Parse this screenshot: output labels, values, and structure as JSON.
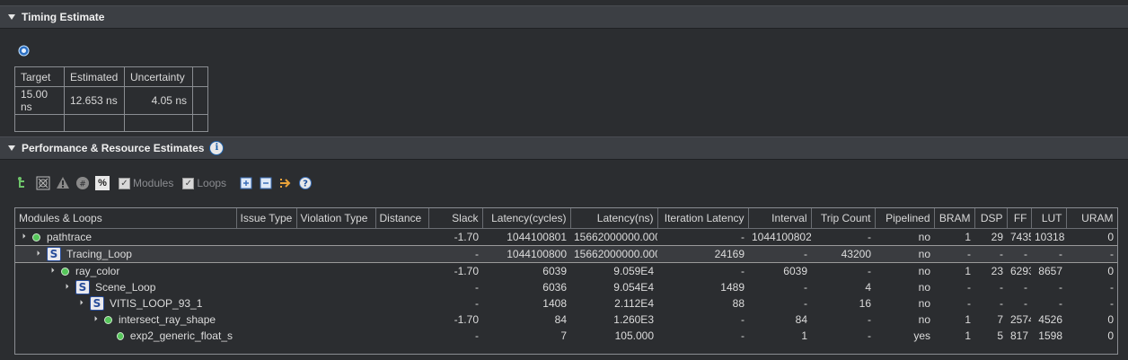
{
  "timing_section": {
    "title": "Timing Estimate"
  },
  "timing_table": {
    "headers": [
      "Target",
      "Estimated",
      "Uncertainty",
      ""
    ],
    "rows": [
      [
        "15.00 ns",
        "12.653 ns",
        "4.05 ns",
        ""
      ],
      [
        "",
        "",
        "",
        ""
      ]
    ]
  },
  "perf_section": {
    "title": "Performance & Resource Estimates"
  },
  "toolbar": {
    "modules_label": "Modules",
    "loops_label": "Loops"
  },
  "grid": {
    "headers": [
      "Modules & Loops",
      "Issue Type",
      "Violation Type",
      "Distance",
      "Slack",
      "Latency(cycles)",
      "Latency(ns)",
      "Iteration Latency",
      "Interval",
      "Trip Count",
      "Pipelined",
      "BRAM",
      "DSP",
      "FF",
      "LUT",
      "URAM"
    ],
    "rows": [
      {
        "name": "pathtrace",
        "type": "module",
        "level": 0,
        "cells": [
          "",
          "",
          "",
          "-1.70",
          "1044100801",
          "15662000000.000",
          "-",
          "1044100802",
          "-",
          "no",
          "1",
          "29",
          "7435",
          "10318",
          "0"
        ]
      },
      {
        "name": "Tracing_Loop",
        "type": "loop",
        "level": 1,
        "cells": [
          "",
          "",
          "",
          "-",
          "1044100800",
          "15662000000.000",
          "24169",
          "-",
          "43200",
          "no",
          "-",
          "-",
          "-",
          "-",
          "-"
        ]
      },
      {
        "name": "ray_color",
        "type": "module",
        "level": 2,
        "cells": [
          "",
          "",
          "",
          "-1.70",
          "6039",
          "9.059E4",
          "-",
          "6039",
          "-",
          "no",
          "1",
          "23",
          "6293",
          "8657",
          "0"
        ]
      },
      {
        "name": "Scene_Loop",
        "type": "loop",
        "level": 3,
        "cells": [
          "",
          "",
          "",
          "-",
          "6036",
          "9.054E4",
          "1489",
          "-",
          "4",
          "no",
          "-",
          "-",
          "-",
          "-",
          "-"
        ]
      },
      {
        "name": "VITIS_LOOP_93_1",
        "type": "loop",
        "level": 4,
        "cells": [
          "",
          "",
          "",
          "-",
          "1408",
          "2.112E4",
          "88",
          "-",
          "16",
          "no",
          "-",
          "-",
          "-",
          "-",
          "-"
        ]
      },
      {
        "name": "intersect_ray_shape",
        "type": "module",
        "level": 5,
        "cells": [
          "",
          "",
          "",
          "-1.70",
          "84",
          "1.260E3",
          "-",
          "84",
          "-",
          "no",
          "1",
          "7",
          "2574",
          "4526",
          "0"
        ]
      },
      {
        "name": "exp2_generic_float_s",
        "type": "module",
        "level": 6,
        "cells": [
          "",
          "",
          "",
          "-",
          "7",
          "105.000",
          "-",
          "1",
          "-",
          "yes",
          "1",
          "5",
          "817",
          "1598",
          "0"
        ]
      }
    ]
  }
}
